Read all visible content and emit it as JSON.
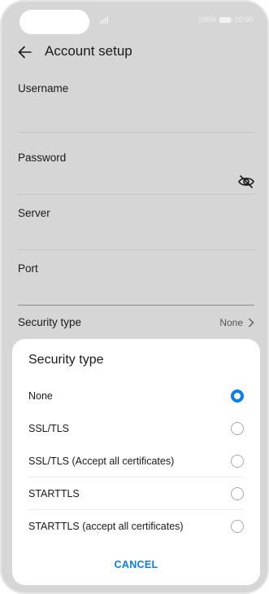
{
  "status_bar": {
    "battery_percent": "100%",
    "time": "10:00"
  },
  "header": {
    "title": "Account setup",
    "back_icon": "arrow-left-icon"
  },
  "form": {
    "username_label": "Username",
    "password_label": "Password",
    "password_toggle_icon": "eye-off-icon",
    "server_label": "Server",
    "port_label": "Port",
    "security_label": "Security type",
    "security_value": "None"
  },
  "sheet": {
    "title": "Security type",
    "options": [
      {
        "label": "None",
        "selected": true
      },
      {
        "label": "SSL/TLS",
        "selected": false
      },
      {
        "label": "SSL/TLS (Accept all certificates)",
        "selected": false
      },
      {
        "label": "STARTTLS",
        "selected": false
      },
      {
        "label": "STARTTLS (accept all certificates)",
        "selected": false
      }
    ],
    "cancel_label": "CANCEL"
  },
  "colors": {
    "accent": "#0a7ef0",
    "dim_background": "#d6d6d6"
  }
}
